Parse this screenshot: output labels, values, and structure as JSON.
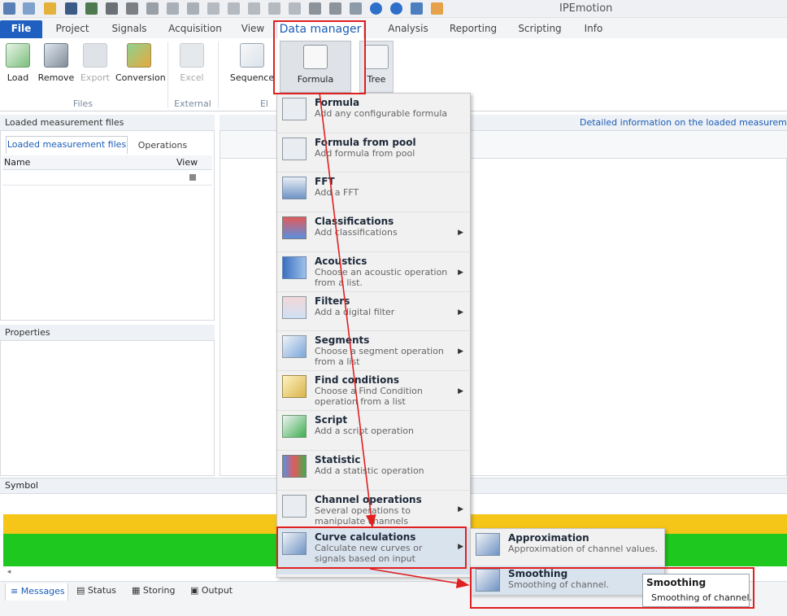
{
  "window": {
    "title": "IPEmotion"
  },
  "ribbon": {
    "tabs": [
      {
        "label": "File"
      },
      {
        "label": "Project"
      },
      {
        "label": "Signals"
      },
      {
        "label": "Acquisition"
      },
      {
        "label": "View"
      },
      {
        "label": "Data manager"
      },
      {
        "label": "Analysis"
      },
      {
        "label": "Reporting"
      },
      {
        "label": "Scripting"
      },
      {
        "label": "Info"
      }
    ],
    "buttons": {
      "load": "Load",
      "remove": "Remove",
      "export": "Export",
      "conversion": "Conversion",
      "excel": "Excel",
      "sequence": "Sequence",
      "formula": "Formula",
      "tree": "Tree"
    },
    "groups": {
      "files": "Files",
      "external": "External",
      "el": "El"
    }
  },
  "left_panel": {
    "title": "Loaded measurement files",
    "tabs": [
      "Loaded measurement files",
      "Operations"
    ],
    "columns": [
      "Name",
      "View"
    ],
    "properties_title": "Properties"
  },
  "right_panel": {
    "info": "Detailed information on the loaded measurement"
  },
  "symbol_label": "Symbol",
  "bottom_tabs": [
    "Messages",
    "Status",
    "Storing",
    "Output"
  ],
  "colors": {
    "accent": "#1a5db6",
    "file_tab": "#1f5fbf",
    "yellow_band": "#f5c518",
    "green_band": "#1ec81e",
    "highlight": "#e02020"
  },
  "menu": {
    "items": [
      {
        "title": "Formula",
        "desc": "Add any configurable formula",
        "icon": "formula-icon"
      },
      {
        "title": "Formula from pool",
        "desc": "Add formula from pool",
        "icon": "formula-pool-icon"
      },
      {
        "title": "FFT",
        "desc": "Add a FFT",
        "icon": "fft-icon"
      },
      {
        "title": "Classifications",
        "desc": "Add classifications",
        "icon": "classifications-icon"
      },
      {
        "title": "Acoustics",
        "desc": "Choose an acoustic operation from a list.",
        "icon": "acoustics-icon"
      },
      {
        "title": "Filters",
        "desc": "Add a digital filter",
        "icon": "filters-icon"
      },
      {
        "title": "Segments",
        "desc": "Choose a segment operation from a list",
        "icon": "segments-icon"
      },
      {
        "title": "Find conditions",
        "desc": "Choose a Find Condition operation from a list",
        "icon": "find-conditions-icon"
      },
      {
        "title": "Script",
        "desc": "Add a script operation",
        "icon": "script-icon"
      },
      {
        "title": "Statistic",
        "desc": "Add a statistic operation",
        "icon": "statistic-icon"
      },
      {
        "title": "Channel operations",
        "desc": "Several operations to manipulate channels",
        "icon": "channel-operations-icon"
      },
      {
        "title": "Curve calculations",
        "desc": "Calculate new curves or signals based on input",
        "icon": "curve-calculations-icon"
      }
    ]
  },
  "submenu": {
    "items": [
      {
        "title": "Approximation",
        "desc": "Approximation of channel values."
      },
      {
        "title": "Smoothing",
        "desc": "Smoothing of channel."
      }
    ]
  },
  "tooltip": {
    "title": "Smoothing",
    "desc": "Smoothing of channel."
  }
}
